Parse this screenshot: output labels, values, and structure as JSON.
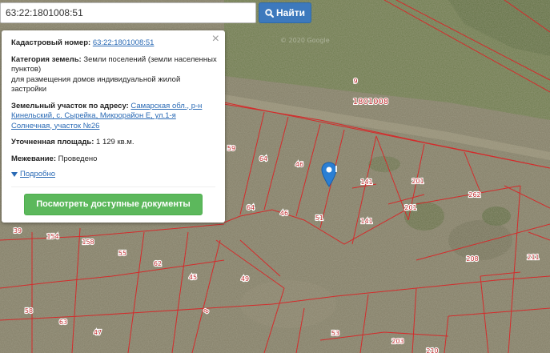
{
  "search": {
    "value": "63:22:1801008:51",
    "button_label": "Найти"
  },
  "popup": {
    "cadastral_label": "Кадастровый номер:",
    "cadastral_value": "63:22:1801008:51",
    "category_label": "Категория земель:",
    "category_value": "Земли поселений (земли населенных пунктов)",
    "category_use": "для размещения домов индивидуальной жилой застройки",
    "address_label": "Земельный участок по адресу:",
    "address_value": "Самарская обл., р-н Кинельский, с. Сырейка, Микрорайон Е, ул.1-я Солнечная, участок №26",
    "area_label": "Уточненная площадь:",
    "area_value": "1 129 кв.м.",
    "survey_label": "Межевание:",
    "survey_value": "Проведено",
    "more_label": "Подробно",
    "docs_button": "Посмотреть доступные документы",
    "close": "×"
  },
  "map": {
    "watermark": "© 2020 Google",
    "block_number": "1801008",
    "parcel_labels": [
      {
        "id": "p9",
        "text": "9"
      },
      {
        "id": "p59",
        "text": "59"
      },
      {
        "id": "p64a",
        "text": "64"
      },
      {
        "id": "p46a",
        "text": "46"
      },
      {
        "id": "p141a",
        "text": "141"
      },
      {
        "id": "p201a",
        "text": "201"
      },
      {
        "id": "p201b",
        "text": "201"
      },
      {
        "id": "p262",
        "text": "262"
      },
      {
        "id": "p64b",
        "text": "64"
      },
      {
        "id": "p46b",
        "text": "46"
      },
      {
        "id": "p51",
        "text": "51"
      },
      {
        "id": "p141b",
        "text": "141"
      },
      {
        "id": "p39",
        "text": "39"
      },
      {
        "id": "p154",
        "text": "154"
      },
      {
        "id": "p158",
        "text": "158"
      },
      {
        "id": "p55",
        "text": "55"
      },
      {
        "id": "p62",
        "text": "62"
      },
      {
        "id": "p45",
        "text": "45"
      },
      {
        "id": "p49",
        "text": "49"
      },
      {
        "id": "p208",
        "text": "208"
      },
      {
        "id": "p211",
        "text": "211"
      },
      {
        "id": "p58",
        "text": "58"
      },
      {
        "id": "p63",
        "text": "63"
      },
      {
        "id": "p47",
        "text": "47"
      },
      {
        "id": "p8",
        "text": "8"
      },
      {
        "id": "p53",
        "text": "53"
      },
      {
        "id": "p203",
        "text": "203"
      },
      {
        "id": "p210",
        "text": "210"
      }
    ]
  },
  "colors": {
    "parcel_border": "#d42b2b",
    "label_color": "#c03030",
    "search_button": "#3d79bd",
    "docs_button": "#5cb85c",
    "link": "#2a6ab5",
    "marker": "#2a7fd4"
  }
}
